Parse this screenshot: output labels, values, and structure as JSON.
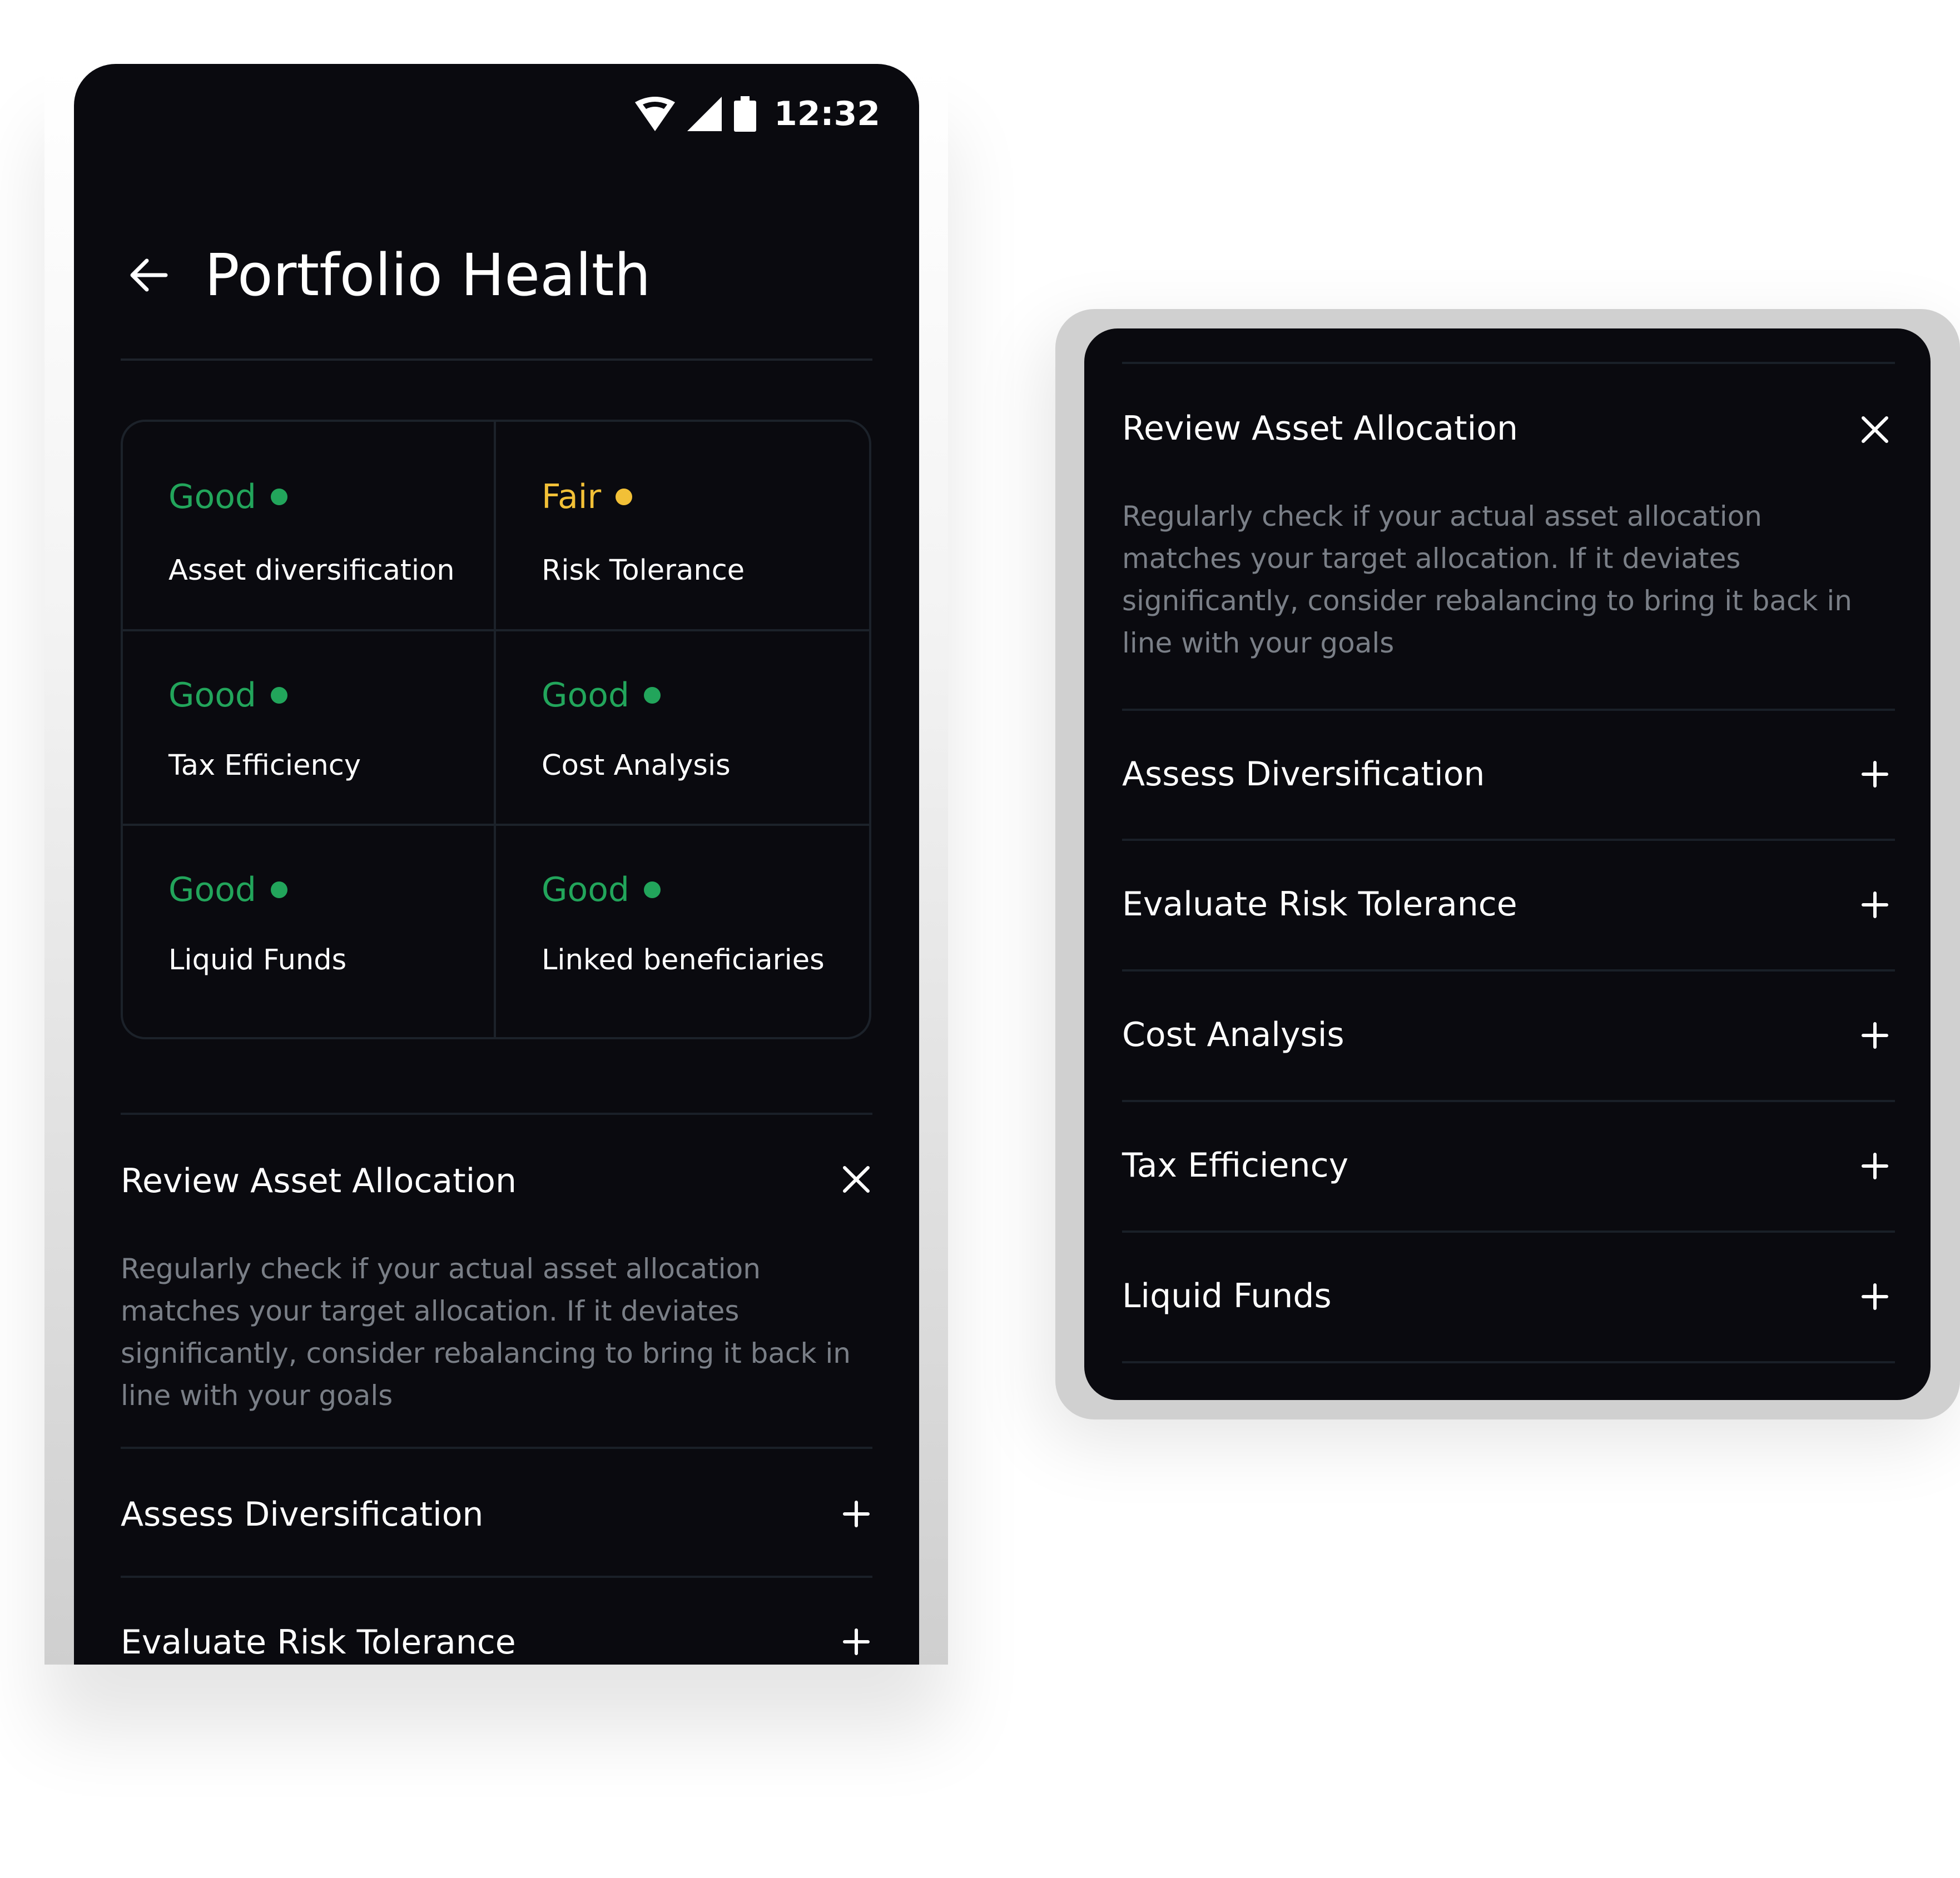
{
  "status_bar": {
    "time": "12:32",
    "icons": [
      "wifi-icon",
      "signal-icon",
      "battery-icon"
    ]
  },
  "header": {
    "back_icon": "arrow-left-icon",
    "title": "Portfolio Health"
  },
  "colors": {
    "good": "#22a55b",
    "fair": "#f2c037",
    "background": "#0a0a0f",
    "muted_text": "#7a7f87",
    "divider": "#1c222a"
  },
  "health_grid": [
    {
      "status": "Good",
      "label": "Asset diversification",
      "level": "good"
    },
    {
      "status": "Fair",
      "label": "Risk Tolerance",
      "level": "fair"
    },
    {
      "status": "Good",
      "label": "Tax Efficiency",
      "level": "good"
    },
    {
      "status": "Good",
      "label": "Cost Analysis",
      "level": "good"
    },
    {
      "status": "Good",
      "label": "Liquid Funds",
      "level": "good"
    },
    {
      "status": "Good",
      "label": "Linked beneficiaries",
      "level": "good"
    }
  ],
  "phone_accordion": {
    "expanded": {
      "title": "Review Asset Allocation",
      "description": "Regularly check if your actual asset allocation matches your target allocation. If it deviates significantly, consider rebalancing to bring it back in line with your goals"
    },
    "items": [
      {
        "title": "Assess Diversification"
      },
      {
        "title": "Evaluate Risk Tolerance"
      }
    ]
  },
  "card_accordion": {
    "expanded": {
      "title": "Review Asset Allocation",
      "description": "Regularly check if your actual asset allocation matches your target allocation. If it deviates significantly, consider rebalancing to bring it back in line with your goals"
    },
    "items": [
      {
        "title": "Assess Diversification"
      },
      {
        "title": "Evaluate Risk Tolerance"
      },
      {
        "title": "Cost Analysis"
      },
      {
        "title": "Tax Efficiency"
      },
      {
        "title": "Liquid Funds"
      }
    ]
  }
}
